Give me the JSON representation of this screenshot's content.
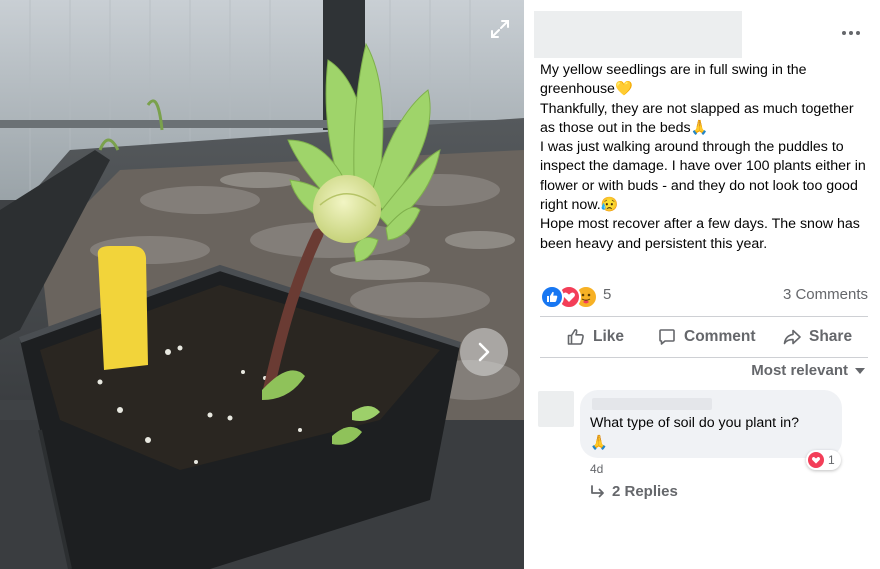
{
  "post": {
    "text": [
      "My yellow seedlings are in full swing in the greenhouse💛",
      "Thankfully, they are not slapped as much together as those out in the beds🙏",
      "I was just walking around through the puddles to inspect the damage. I have over 100 plants either in flower or with buds - and they do not look too good right now.😥",
      "Hope most recover after a few days. The snow has been heavy and persistent this year."
    ],
    "reactions": {
      "count": "5",
      "icons": [
        "like-icon",
        "love-icon",
        "care-icon"
      ]
    },
    "comments_count": "3 Comments"
  },
  "actions": {
    "like": "Like",
    "comment": "Comment",
    "share": "Share"
  },
  "sort": {
    "label": "Most relevant"
  },
  "comment": {
    "text": "What type of soil do you plant in?",
    "emoji": "🙏",
    "time": "4d",
    "reaction_count": "1",
    "replies": "2 Replies"
  },
  "colors": {
    "like_blue": "#1877f2",
    "love_red": "#f33e58",
    "care_yellow": "#f7b125",
    "muted_text": "#65676b",
    "bubble_bg": "#f0f2f5"
  }
}
